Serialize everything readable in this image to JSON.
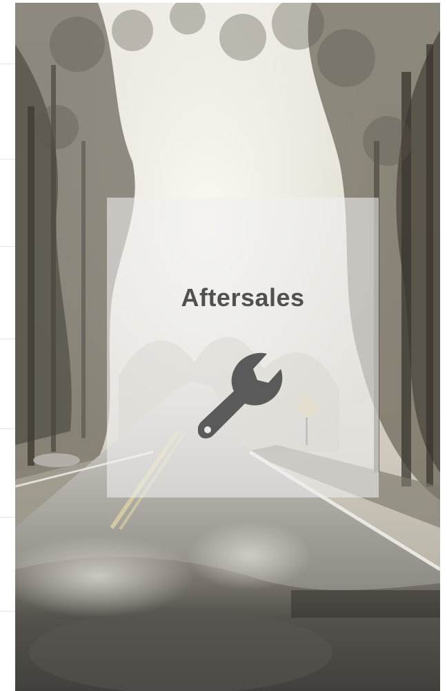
{
  "card": {
    "title": "Aftersales",
    "icon": "wrench-icon"
  },
  "colors": {
    "title_text": "#505050",
    "icon_fill": "#5a5a5a",
    "card_background": "rgba(240,240,240,0.58)"
  }
}
